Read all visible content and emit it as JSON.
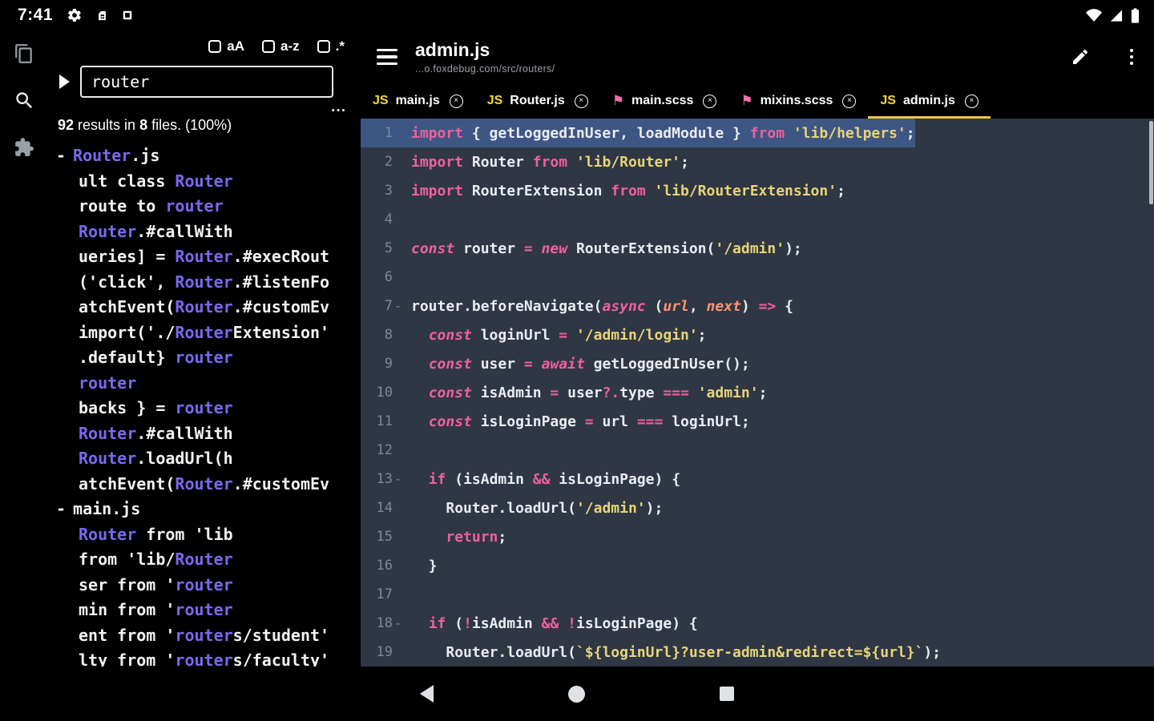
{
  "status_bar": {
    "time": "7:41",
    "left_icons": [
      "gear-icon",
      "sim-card-icon",
      "screen-icon"
    ],
    "right_icons": [
      "wifi-icon",
      "signal-icon",
      "battery-icon"
    ]
  },
  "activity_bar": {
    "icons": [
      "files-icon",
      "search-icon",
      "extensions-icon"
    ]
  },
  "search_panel": {
    "options": [
      {
        "label": "aA",
        "checked": false
      },
      {
        "label": "a-z",
        "checked": false
      },
      {
        "label": ".*",
        "checked": false
      }
    ],
    "query": "router",
    "more_label": "...",
    "summary_segments": [
      {
        "text": "92",
        "bold": true
      },
      {
        "text": " results in ",
        "bold": false
      },
      {
        "text": "8",
        "bold": true
      },
      {
        "text": " files. (100%)",
        "bold": false
      }
    ],
    "results": [
      {
        "file": true,
        "segments": [
          [
            "Router",
            true
          ],
          [
            ".js",
            false
          ]
        ]
      },
      {
        "file": false,
        "segments": [
          [
            "ult class ",
            false
          ],
          [
            "Router",
            true
          ]
        ]
      },
      {
        "file": false,
        "segments": [
          [
            "route to ",
            false
          ],
          [
            "router",
            true
          ]
        ]
      },
      {
        "file": false,
        "segments": [
          [
            "Router",
            true
          ],
          [
            ".#callWith",
            false
          ]
        ]
      },
      {
        "file": false,
        "segments": [
          [
            "ueries] = ",
            false
          ],
          [
            "Router",
            true
          ],
          [
            ".#execRout",
            false
          ]
        ]
      },
      {
        "file": false,
        "segments": [
          [
            "('click', ",
            false
          ],
          [
            "Router",
            true
          ],
          [
            ".#listenFo",
            false
          ]
        ]
      },
      {
        "file": false,
        "segments": [
          [
            "atchEvent(",
            false
          ],
          [
            "Router",
            true
          ],
          [
            ".#customEv",
            false
          ]
        ]
      },
      {
        "file": false,
        "segments": [
          [
            "import('./",
            false
          ],
          [
            "Router",
            true
          ],
          [
            "Extension'",
            false
          ]
        ]
      },
      {
        "file": false,
        "segments": [
          [
            ".default} ",
            false
          ],
          [
            "router",
            true
          ]
        ]
      },
      {
        "file": false,
        "segments": [
          [
            "router",
            true
          ]
        ]
      },
      {
        "file": false,
        "segments": [
          [
            "backs } = ",
            false
          ],
          [
            "router",
            true
          ]
        ]
      },
      {
        "file": false,
        "segments": [
          [
            "Router",
            true
          ],
          [
            ".#callWith",
            false
          ]
        ]
      },
      {
        "file": false,
        "segments": [
          [
            "Router",
            true
          ],
          [
            ".loadUrl(h",
            false
          ]
        ]
      },
      {
        "file": false,
        "segments": [
          [
            "atchEvent(",
            false
          ],
          [
            "Router",
            true
          ],
          [
            ".#customEv",
            false
          ]
        ]
      },
      {
        "file": true,
        "segments": [
          [
            "main.js",
            false
          ]
        ]
      },
      {
        "file": false,
        "segments": [
          [
            "Router",
            true
          ],
          [
            " from 'lib",
            false
          ]
        ]
      },
      {
        "file": false,
        "segments": [
          [
            "from 'lib/",
            false
          ],
          [
            "Router",
            true
          ]
        ]
      },
      {
        "file": false,
        "segments": [
          [
            "ser from '",
            false
          ],
          [
            "router",
            true
          ]
        ]
      },
      {
        "file": false,
        "segments": [
          [
            "min from '",
            false
          ],
          [
            "router",
            true
          ]
        ]
      },
      {
        "file": false,
        "segments": [
          [
            "ent from '",
            false
          ],
          [
            "router",
            true
          ],
          [
            "s/student'",
            false
          ]
        ]
      },
      {
        "file": false,
        "segments": [
          [
            "lty from '",
            false
          ],
          [
            "router",
            true
          ],
          [
            "s/faculty'",
            false
          ]
        ]
      }
    ]
  },
  "header": {
    "title": "admin.js",
    "subtitle": "...o.foxdebug.com/src/routers/"
  },
  "tabs": [
    {
      "icon": "js",
      "label": "main.js",
      "active": false
    },
    {
      "icon": "js",
      "label": "Router.js",
      "active": false
    },
    {
      "icon": "scss",
      "label": "main.scss",
      "active": false
    },
    {
      "icon": "scss",
      "label": "mixins.scss",
      "active": false
    },
    {
      "icon": "js",
      "label": "admin.js",
      "active": true
    }
  ],
  "editor": {
    "lines": [
      {
        "n": 1,
        "sel": true,
        "fold": false,
        "tokens": [
          [
            "kw",
            "import"
          ],
          [
            "pl",
            " { "
          ],
          [
            "id",
            "getLoggedInUser"
          ],
          [
            "pl",
            ", "
          ],
          [
            "id",
            "loadModule"
          ],
          [
            "pl",
            " } "
          ],
          [
            "kw",
            "from"
          ],
          [
            "pl",
            " "
          ],
          [
            "str",
            "'lib/helpers'"
          ],
          [
            "pl",
            ";"
          ]
        ]
      },
      {
        "n": 2,
        "sel": false,
        "fold": false,
        "tokens": [
          [
            "kw",
            "import"
          ],
          [
            "pl",
            " "
          ],
          [
            "id",
            "Router"
          ],
          [
            "pl",
            " "
          ],
          [
            "kw",
            "from"
          ],
          [
            "pl",
            " "
          ],
          [
            "str",
            "'lib/Router'"
          ],
          [
            "pl",
            ";"
          ]
        ]
      },
      {
        "n": 3,
        "sel": false,
        "fold": false,
        "tokens": [
          [
            "kw",
            "import"
          ],
          [
            "pl",
            " "
          ],
          [
            "id",
            "RouterExtension"
          ],
          [
            "pl",
            " "
          ],
          [
            "kw",
            "from"
          ],
          [
            "pl",
            " "
          ],
          [
            "str",
            "'lib/RouterExtension'"
          ],
          [
            "pl",
            ";"
          ]
        ]
      },
      {
        "n": 4,
        "sel": false,
        "fold": false,
        "tokens": []
      },
      {
        "n": 5,
        "sel": false,
        "fold": false,
        "tokens": [
          [
            "kwi",
            "const"
          ],
          [
            "pl",
            " "
          ],
          [
            "id",
            "router"
          ],
          [
            "pl",
            " "
          ],
          [
            "op",
            "="
          ],
          [
            "pl",
            " "
          ],
          [
            "kwi",
            "new"
          ],
          [
            "pl",
            " "
          ],
          [
            "id",
            "RouterExtension"
          ],
          [
            "pl",
            "("
          ],
          [
            "str",
            "'/admin'"
          ],
          [
            "pl",
            ");"
          ]
        ]
      },
      {
        "n": 6,
        "sel": false,
        "fold": false,
        "tokens": []
      },
      {
        "n": 7,
        "sel": false,
        "fold": true,
        "tokens": [
          [
            "id",
            "router"
          ],
          [
            "pl",
            "."
          ],
          [
            "id",
            "beforeNavigate"
          ],
          [
            "pl",
            "("
          ],
          [
            "kwi",
            "async"
          ],
          [
            "pl",
            " ("
          ],
          [
            "param",
            "url"
          ],
          [
            "pl",
            ", "
          ],
          [
            "param",
            "next"
          ],
          [
            "pl",
            ") "
          ],
          [
            "op",
            "=>"
          ],
          [
            "pl",
            " {"
          ]
        ]
      },
      {
        "n": 8,
        "sel": false,
        "fold": false,
        "tokens": [
          [
            "pl",
            "  "
          ],
          [
            "kwi",
            "const"
          ],
          [
            "pl",
            " "
          ],
          [
            "id",
            "loginUrl"
          ],
          [
            "pl",
            " "
          ],
          [
            "op",
            "="
          ],
          [
            "pl",
            " "
          ],
          [
            "str",
            "'/admin/login'"
          ],
          [
            "pl",
            ";"
          ]
        ]
      },
      {
        "n": 9,
        "sel": false,
        "fold": false,
        "tokens": [
          [
            "pl",
            "  "
          ],
          [
            "kwi",
            "const"
          ],
          [
            "pl",
            " "
          ],
          [
            "id",
            "user"
          ],
          [
            "pl",
            " "
          ],
          [
            "op",
            "="
          ],
          [
            "pl",
            " "
          ],
          [
            "kwi",
            "await"
          ],
          [
            "pl",
            " "
          ],
          [
            "id",
            "getLoggedInUser"
          ],
          [
            "pl",
            "();"
          ]
        ]
      },
      {
        "n": 10,
        "sel": false,
        "fold": false,
        "tokens": [
          [
            "pl",
            "  "
          ],
          [
            "kwi",
            "const"
          ],
          [
            "pl",
            " "
          ],
          [
            "id",
            "isAdmin"
          ],
          [
            "pl",
            " "
          ],
          [
            "op",
            "="
          ],
          [
            "pl",
            " "
          ],
          [
            "id",
            "user"
          ],
          [
            "op",
            "?."
          ],
          [
            "id",
            "type"
          ],
          [
            "pl",
            " "
          ],
          [
            "op",
            "==="
          ],
          [
            "pl",
            " "
          ],
          [
            "str",
            "'admin'"
          ],
          [
            "pl",
            ";"
          ]
        ]
      },
      {
        "n": 11,
        "sel": false,
        "fold": false,
        "tokens": [
          [
            "pl",
            "  "
          ],
          [
            "kwi",
            "const"
          ],
          [
            "pl",
            " "
          ],
          [
            "id",
            "isLoginPage"
          ],
          [
            "pl",
            " "
          ],
          [
            "op",
            "="
          ],
          [
            "pl",
            " "
          ],
          [
            "id",
            "url"
          ],
          [
            "pl",
            " "
          ],
          [
            "op",
            "==="
          ],
          [
            "pl",
            " "
          ],
          [
            "id",
            "loginUrl"
          ],
          [
            "pl",
            ";"
          ]
        ]
      },
      {
        "n": 12,
        "sel": false,
        "fold": false,
        "tokens": []
      },
      {
        "n": 13,
        "sel": false,
        "fold": true,
        "tokens": [
          [
            "pl",
            "  "
          ],
          [
            "kw",
            "if"
          ],
          [
            "pl",
            " ("
          ],
          [
            "id",
            "isAdmin"
          ],
          [
            "pl",
            " "
          ],
          [
            "op",
            "&&"
          ],
          [
            "pl",
            " "
          ],
          [
            "id",
            "isLoginPage"
          ],
          [
            "pl",
            ") {"
          ]
        ]
      },
      {
        "n": 14,
        "sel": false,
        "fold": false,
        "tokens": [
          [
            "pl",
            "    "
          ],
          [
            "id",
            "Router"
          ],
          [
            "pl",
            "."
          ],
          [
            "id",
            "loadUrl"
          ],
          [
            "pl",
            "("
          ],
          [
            "str",
            "'/admin'"
          ],
          [
            "pl",
            ");"
          ]
        ]
      },
      {
        "n": 15,
        "sel": false,
        "fold": false,
        "tokens": [
          [
            "pl",
            "    "
          ],
          [
            "kw",
            "return"
          ],
          [
            "pl",
            ";"
          ]
        ]
      },
      {
        "n": 16,
        "sel": false,
        "fold": false,
        "tokens": [
          [
            "pl",
            "  }"
          ]
        ]
      },
      {
        "n": 17,
        "sel": false,
        "fold": false,
        "tokens": []
      },
      {
        "n": 18,
        "sel": false,
        "fold": true,
        "tokens": [
          [
            "pl",
            "  "
          ],
          [
            "kw",
            "if"
          ],
          [
            "pl",
            " ("
          ],
          [
            "op",
            "!"
          ],
          [
            "id",
            "isAdmin"
          ],
          [
            "pl",
            " "
          ],
          [
            "op",
            "&&"
          ],
          [
            "pl",
            " "
          ],
          [
            "op",
            "!"
          ],
          [
            "id",
            "isLoginPage"
          ],
          [
            "pl",
            ") {"
          ]
        ]
      },
      {
        "n": 19,
        "sel": false,
        "fold": false,
        "tokens": [
          [
            "pl",
            "    "
          ],
          [
            "id",
            "Router"
          ],
          [
            "pl",
            "."
          ],
          [
            "id",
            "loadUrl"
          ],
          [
            "pl",
            "("
          ],
          [
            "str",
            "`${loginUrl}?user-admin&redirect=${url}`"
          ],
          [
            "pl",
            ");"
          ]
        ]
      }
    ]
  },
  "nav_bar": {
    "icons": [
      "back-button",
      "home-button",
      "recents-button"
    ]
  },
  "colors": {
    "accent_tab_underline": "#eec643",
    "match_highlight": "#7b68ee",
    "keyword_pink": "#f0609a",
    "string_yellow": "#e8d477",
    "param_orange": "#fc9272",
    "selection_blue": "#3d5684",
    "editor_background": "#2f3744",
    "js_icon": "#f5d83a",
    "scss_icon": "#f06daa"
  }
}
